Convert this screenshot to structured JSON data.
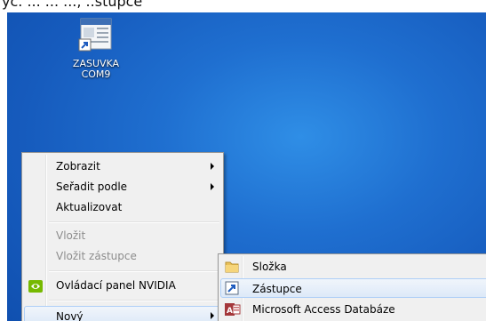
{
  "caption": {
    "text": "yč. ... ... ..., ..stupce"
  },
  "desktop_icon": {
    "label_line1": "ZASUVKA",
    "label_line2": "COM9"
  },
  "context_menu": {
    "items": [
      {
        "label": "Zobrazit",
        "submenu": true,
        "enabled": true
      },
      {
        "label": "Seřadit podle",
        "submenu": true,
        "enabled": true
      },
      {
        "label": "Aktualizovat",
        "submenu": false,
        "enabled": true
      },
      {
        "label": "Vložit",
        "submenu": false,
        "enabled": false
      },
      {
        "label": "Vložit zástupce",
        "submenu": false,
        "enabled": false
      },
      {
        "label": "Ovládací panel NVIDIA",
        "submenu": false,
        "enabled": true,
        "icon": "nvidia-icon"
      },
      {
        "label": "Nový",
        "submenu": true,
        "enabled": true,
        "highlighted": true
      }
    ]
  },
  "new_submenu": {
    "items": [
      {
        "label": "Složka",
        "icon": "folder-icon"
      },
      {
        "label": "Zástupce",
        "icon": "shortcut-icon",
        "highlighted": true
      },
      {
        "label": "Microsoft Access Databáze",
        "icon": "access-icon"
      }
    ]
  },
  "colors": {
    "desktop": "#1f6fd0",
    "menu_bg": "#f0f0f0",
    "highlight_border": "#aecff7",
    "nvidia_green": "#76b900"
  }
}
